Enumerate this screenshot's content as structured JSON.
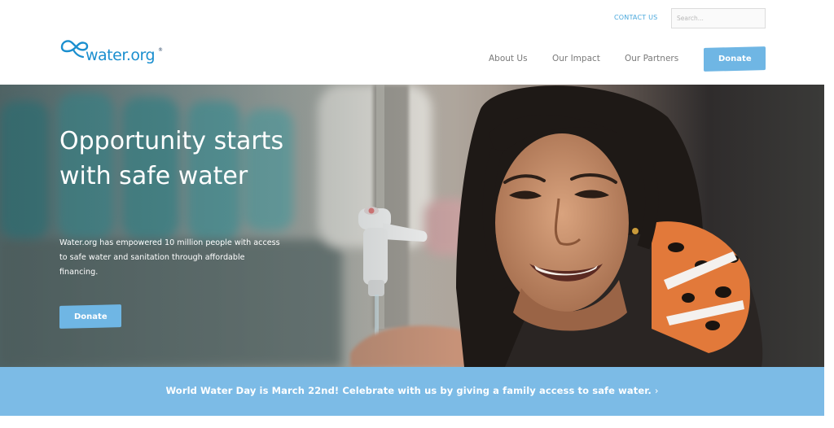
{
  "header": {
    "contact_label": "CONTACT US",
    "search_placeholder": "Search...",
    "logo": {
      "text": "water.org",
      "mark": "®"
    },
    "nav": [
      {
        "label": "About Us"
      },
      {
        "label": "Our Impact"
      },
      {
        "label": "Our Partners"
      }
    ],
    "donate_label": "Donate"
  },
  "hero": {
    "title": "Opportunity starts with safe water",
    "subtitle": "Water.org has empowered 10 million people with access to safe water and sanitation through affordable financing.",
    "donate_label": "Donate"
  },
  "banner": {
    "text": "World Water Day is March 22nd! Celebrate with us by giving a family access to safe water.",
    "chevron": "›"
  },
  "colors": {
    "accent": "#6fb6e4",
    "banner": "#7cbbe6",
    "link": "#4aa8dc",
    "logo": "#1b8fcf"
  },
  "icons": [
    "water-org-logo-infinity-icon",
    "chevron-right-icon"
  ]
}
